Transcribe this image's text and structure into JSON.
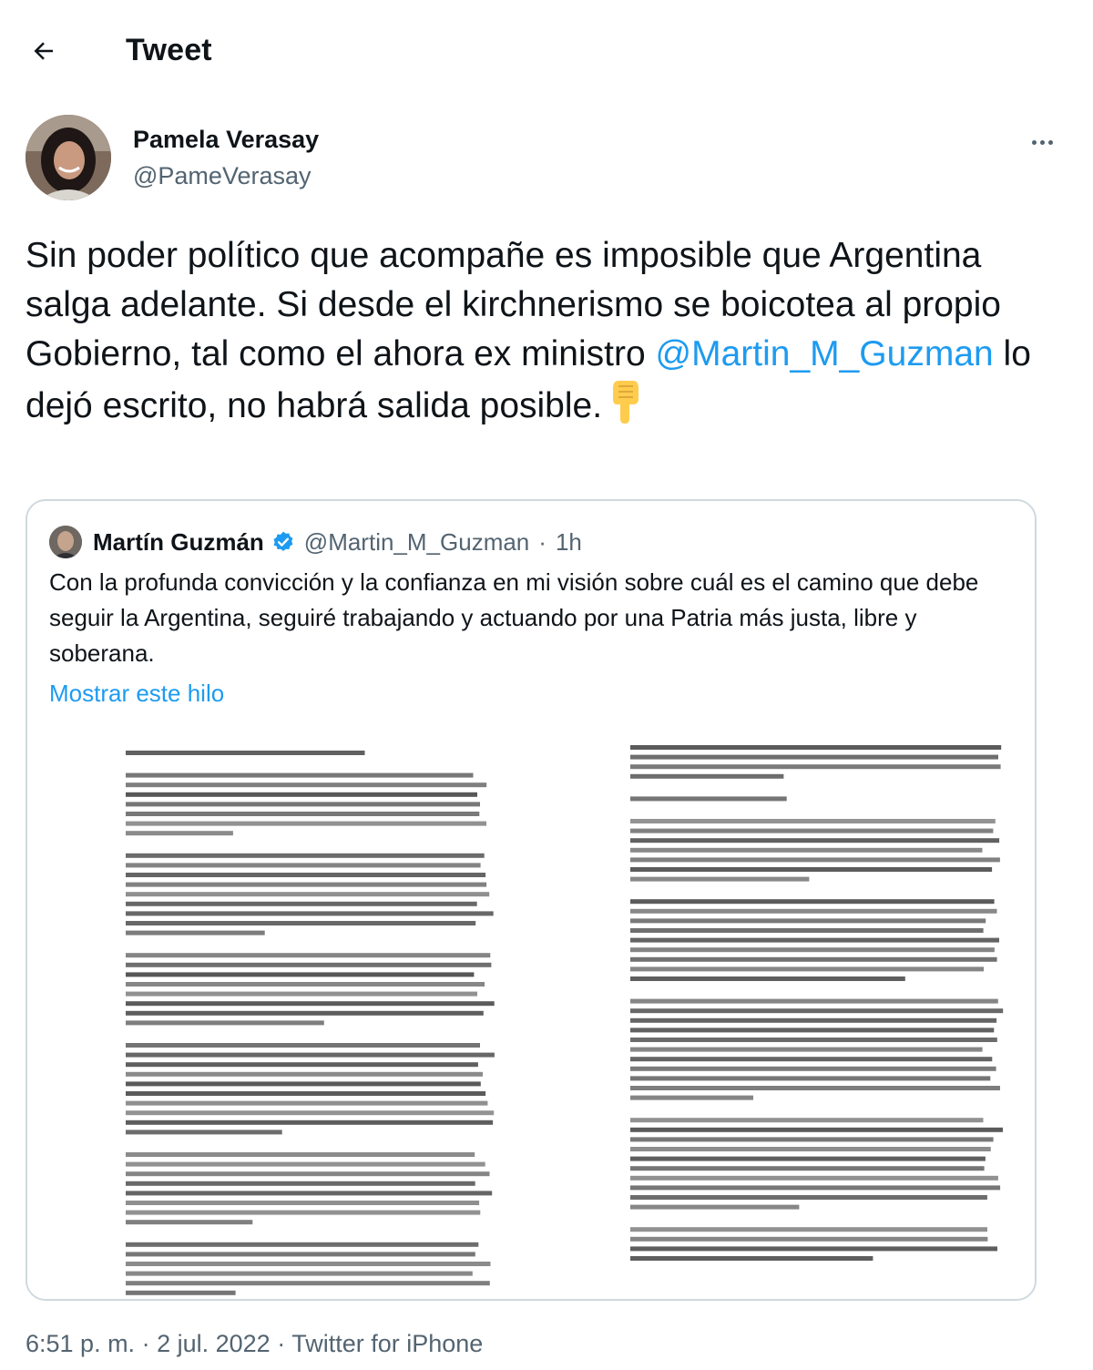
{
  "header": {
    "title": "Tweet",
    "back_icon": "arrow-left-icon"
  },
  "author": {
    "display_name": "Pamela Verasay",
    "handle": "@PameVerasay"
  },
  "tweet": {
    "text_before_mention": "Sin poder político que acompañe es imposible que Argentina salga adelante. Si desde el kirchnerismo se boicotea al propio Gobierno, tal como el ahora ex ministro ",
    "mention": "@Martin_M_Guzman",
    "text_after_mention": " lo dejó escrito, no habrá salida posible.",
    "emoji": "backhand-index-pointing-down"
  },
  "quoted_tweet": {
    "display_name": "Martín Guzmán",
    "verified": true,
    "handle": "@Martin_M_Guzman",
    "time": "1h",
    "text": "Con la profunda convicción y la confianza en mi visión sobre cuál es el camino que debe seguir la Argentina, seguiré trabajando y actuando por una Patria más justa, libre y soberana.",
    "show_thread": "Mostrar este hilo"
  },
  "footer": {
    "time": "6:51 p. m.",
    "date": "2 jul. 2022",
    "source": "Twitter for iPhone"
  },
  "colors": {
    "link": "#1d9bf0",
    "secondary": "#536471",
    "border": "#cfd9de"
  }
}
